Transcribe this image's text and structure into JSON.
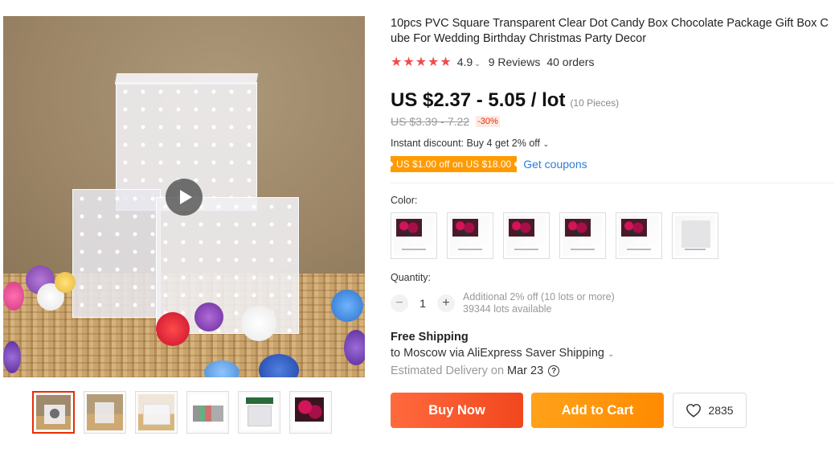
{
  "product": {
    "title": "10pcs PVC Square Transparent Clear Dot Candy Box Chocolate Package Gift Box Cube For Wedding Birthday Christmas Party Decor",
    "stars": "★★★★★",
    "rating": "4.9",
    "reviews": "9 Reviews",
    "orders": "40 orders"
  },
  "price": {
    "current": "US $2.37 - 5.05 / lot",
    "pieces": "(10 Pieces)",
    "original": "US $3.39 - 7.22",
    "discount": "-30%"
  },
  "promo": {
    "instant_discount": "Instant discount: Buy 4 get 2% off",
    "coupon": "US $1.00 off on US $18.00",
    "get_coupons": "Get coupons"
  },
  "options": {
    "color_label": "Color:",
    "quantity_label": "Quantity:",
    "quantity_value": "1",
    "quantity_minus": "−",
    "quantity_plus": "+",
    "additional_discount": "Additional 2% off (10 lots or more)",
    "lots_available": "39344 lots available"
  },
  "shipping": {
    "title": "Free Shipping",
    "to": "to Moscow via AliExpress Saver Shipping",
    "estimated_label": "Estimated Delivery on",
    "estimated_date": "Mar 23",
    "help": "?"
  },
  "actions": {
    "buy_now": "Buy Now",
    "add_to_cart": "Add to Cart",
    "wishlist_count": "2835"
  },
  "colors": {
    "accent_red": "#e62e04",
    "star_red": "#f44b4b",
    "coupon_orange": "#ff9a00",
    "link_blue": "#2e7cd6"
  },
  "icons": {
    "play": "play-icon",
    "heart": "heart-icon",
    "help": "question-circle-icon",
    "caret": "chevron-down-icon"
  }
}
